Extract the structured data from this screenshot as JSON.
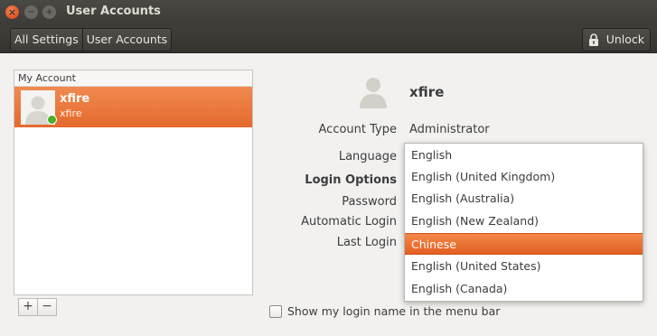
{
  "window": {
    "title": "User Accounts"
  },
  "toolbar": {
    "breadcrumbs": [
      "All Settings",
      "User Accounts"
    ],
    "unlock_label": "Unlock"
  },
  "sidebar": {
    "header": "My Account",
    "users": [
      {
        "name": "xfire",
        "login": "xfire",
        "status": "online",
        "selected": true
      }
    ],
    "add_label": "+",
    "remove_label": "−"
  },
  "account": {
    "name": "xfire",
    "fields": {
      "account_type_label": "Account Type",
      "account_type_value": "Administrator",
      "language_label": "Language",
      "login_options_label": "Login Options",
      "password_label": "Password",
      "automatic_login_label": "Automatic Login",
      "last_login_label": "Last Login"
    }
  },
  "language_menu": {
    "items": [
      "English",
      "English (United Kingdom)",
      "English (Australia)",
      "English (New Zealand)",
      "Chinese",
      "English (United States)",
      "English (Canada)"
    ],
    "selected": "Chinese"
  },
  "show_login_name": {
    "label": "Show my login name in the menu bar",
    "checked": false
  },
  "colors": {
    "accent": "#e95420",
    "titlebar": "#3c3b37",
    "status_online": "#4caf2a"
  },
  "icons": [
    "close-icon",
    "minimize-icon",
    "maximize-icon",
    "lock-icon",
    "user-avatar-icon",
    "add-icon",
    "remove-icon"
  ]
}
